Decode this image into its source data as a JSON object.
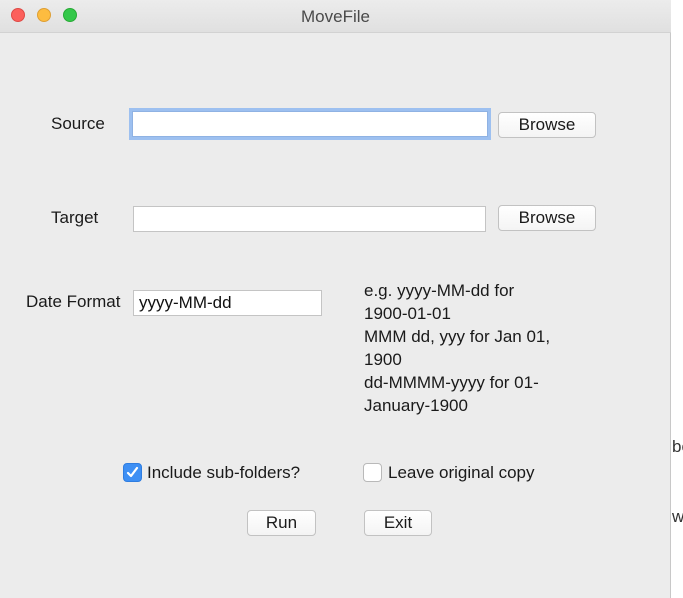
{
  "window": {
    "title": "MoveFile"
  },
  "source": {
    "label": "Source",
    "value": "",
    "browse_label": "Browse"
  },
  "target": {
    "label": "Target",
    "value": "",
    "browse_label": "Browse"
  },
  "date_format": {
    "label": "Date Format",
    "value": "yyyy-MM-dd",
    "hint_lines": [
      "e.g. yyyy-MM-dd for",
      "1900-01-01",
      "MMM dd, yyy for Jan 01,",
      "1900",
      "dd-MMMM-yyyy for 01-",
      "January-1900"
    ]
  },
  "options": {
    "include_subfolders": {
      "label": "Include sub-folders?",
      "checked": true
    },
    "leave_original": {
      "label": "Leave original copy",
      "checked": false
    }
  },
  "actions": {
    "run_label": "Run",
    "exit_label": "Exit"
  },
  "background_fragments": [
    "be",
    "wh"
  ],
  "colors": {
    "focus_ring": "#9dc0f0",
    "checkbox_checked": "#3d8ff4"
  }
}
